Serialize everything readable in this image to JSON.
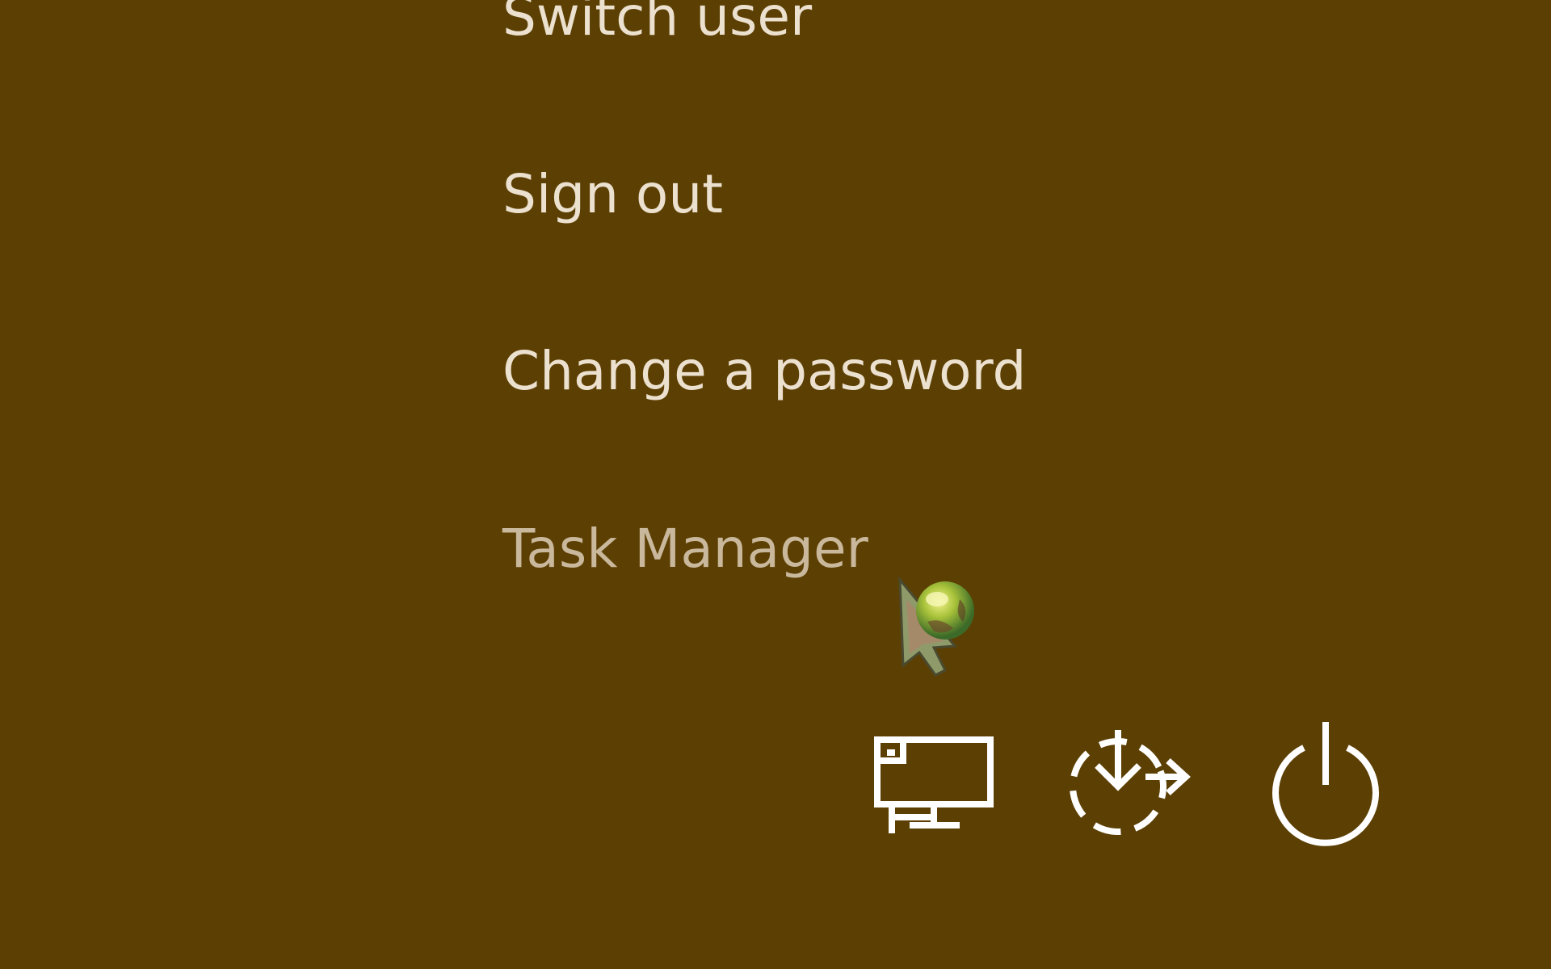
{
  "menu": {
    "items": [
      {
        "label": "Switch user"
      },
      {
        "label": "Sign out"
      },
      {
        "label": "Change a password"
      },
      {
        "label": "Task Manager"
      }
    ]
  },
  "tray": {
    "buttons": [
      {
        "icon": "network-icon"
      },
      {
        "icon": "ease-of-access-icon"
      },
      {
        "icon": "power-icon"
      }
    ]
  },
  "cursor": {
    "icon": "busy-cursor-icon"
  },
  "colors": {
    "background": "#5c3f02",
    "text": "#ece0cf",
    "text_dim": "#c9b89c",
    "icon": "#ffffff"
  }
}
